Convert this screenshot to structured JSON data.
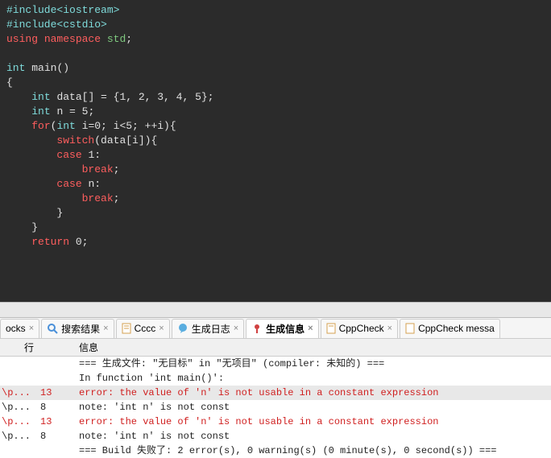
{
  "code": {
    "l1a": "#include",
    "l1b": "<iostream>",
    "l2a": "#include",
    "l2b": "<cstdio>",
    "l3a": "using",
    "l3b": "namespace",
    "l3c": "std",
    "l3d": ";",
    "l5a": "int",
    "l5b": "main",
    "l5c": "()",
    "l6": "{",
    "l7a": "int",
    "l7b": "data[] = {1, 2, 3, 4, 5};",
    "l8a": "int",
    "l8b": "n = 5;",
    "l9a": "for",
    "l9b": "(",
    "l9c": "int",
    "l9d": " i=0; i<5; ++i){",
    "l10a": "switch",
    "l10b": "(data[i]){",
    "l11a": "case",
    "l11b": " 1:",
    "l12": "break",
    "l12b": ";",
    "l13a": "case",
    "l13b": " n:",
    "l14": "break",
    "l14b": ";",
    "l15": "}",
    "l16": "}",
    "l17a": "return",
    "l17b": " 0;"
  },
  "tabs": {
    "t0": "ocks",
    "t1": "搜索结果",
    "t2": "Cccc",
    "t3": "生成日志",
    "t4": "生成信息",
    "t5": "CppCheck",
    "t6": "CppCheck messa"
  },
  "headers": {
    "line": "行",
    "msg": "信息"
  },
  "msgs": {
    "r0": {
      "file": "",
      "line": "",
      "text": "=== 生成文件: \"无目标\" in \"无项目\" (compiler: 未知的) ==="
    },
    "r1": {
      "file": "",
      "line": "",
      "text": "In function 'int main()':"
    },
    "r2": {
      "file": "\\p...",
      "line": "13",
      "text": "error: the value of 'n' is not usable in a constant expression"
    },
    "r3": {
      "file": "\\p...",
      "line": "8",
      "text": "note: 'int n' is not const"
    },
    "r4": {
      "file": "\\p...",
      "line": "13",
      "text": "error: the value of 'n' is not usable in a constant expression"
    },
    "r5": {
      "file": "\\p...",
      "line": "8",
      "text": "note: 'int n' is not const"
    },
    "r6": {
      "file": "",
      "line": "",
      "text": "=== Build 失败了: 2 error(s), 0 warning(s) (0 minute(s), 0 second(s)) ==="
    }
  }
}
